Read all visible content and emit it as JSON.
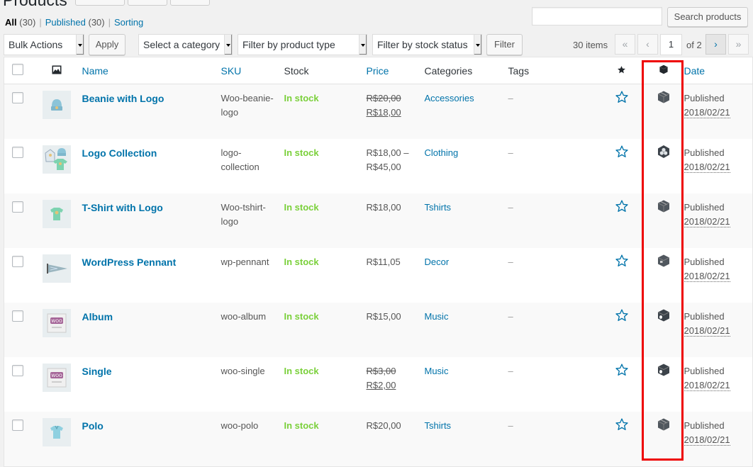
{
  "page": {
    "title": "Products"
  },
  "views": [
    {
      "label": "All",
      "count": "(30)",
      "current": true
    },
    {
      "label": "Published",
      "count": "(30)",
      "current": false
    },
    {
      "label": "Sorting",
      "count": "",
      "current": false
    }
  ],
  "search": {
    "value": "",
    "button_label": "Search products"
  },
  "toolbar": {
    "bulk_actions": "Bulk Actions",
    "apply_label": "Apply",
    "category_select": "Select a category",
    "product_type_select": "Filter by product type",
    "stock_status_select": "Filter by stock status",
    "filter_label": "Filter"
  },
  "pagination": {
    "items": "30 items",
    "first": "«",
    "prev": "‹",
    "current_page": "1",
    "of_total": "of 2",
    "next": "›",
    "last": "»"
  },
  "columns": {
    "name": "Name",
    "sku": "SKU",
    "stock": "Stock",
    "price": "Price",
    "categories": "Categories",
    "tags": "Tags",
    "date": "Date"
  },
  "colors": {
    "link": "#0073aa",
    "in_stock": "#7ad03a",
    "highlight": "#ee0000"
  },
  "products": [
    {
      "name": "Beanie with Logo",
      "sku": "Woo-beanie-logo",
      "stock": "In stock",
      "price_regular": "R$20,00",
      "price_sale": "R$18,00",
      "price": "",
      "category": "Accessories",
      "tags": "–",
      "type_icon": "simple-box-icon",
      "date_status": "Published",
      "date": "2018/02/21",
      "thumb": "beanie"
    },
    {
      "name": "Logo Collection",
      "sku": "logo-collection",
      "stock": "In stock",
      "price_regular": "",
      "price_sale": "",
      "price": "R$18,00 – R$45,00",
      "category": "Clothing",
      "tags": "–",
      "type_icon": "grouped-icon",
      "date_status": "Published",
      "date": "2018/02/21",
      "thumb": "collection"
    },
    {
      "name": "T-Shirt with Logo",
      "sku": "Woo-tshirt-logo",
      "stock": "In stock",
      "price_regular": "",
      "price_sale": "",
      "price": "R$18,00",
      "category": "Tshirts",
      "tags": "–",
      "type_icon": "simple-box-icon",
      "date_status": "Published",
      "date": "2018/02/21",
      "thumb": "tshirt"
    },
    {
      "name": "WordPress Pennant",
      "sku": "wp-pennant",
      "stock": "In stock",
      "price_regular": "",
      "price_sale": "",
      "price": "R$11,05",
      "category": "Decor",
      "tags": "–",
      "type_icon": "external-box-icon",
      "date_status": "Published",
      "date": "2018/02/21",
      "thumb": "pennant"
    },
    {
      "name": "Album",
      "sku": "woo-album",
      "stock": "In stock",
      "price_regular": "",
      "price_sale": "",
      "price": "R$15,00",
      "category": "Music",
      "tags": "–",
      "type_icon": "virtual-box-icon",
      "date_status": "Published",
      "date": "2018/02/21",
      "thumb": "album"
    },
    {
      "name": "Single",
      "sku": "woo-single",
      "stock": "In stock",
      "price_regular": "R$3,00",
      "price_sale": "R$2,00",
      "price": "",
      "category": "Music",
      "tags": "–",
      "type_icon": "virtual-box-icon",
      "date_status": "Published",
      "date": "2018/02/21",
      "thumb": "single"
    },
    {
      "name": "Polo",
      "sku": "woo-polo",
      "stock": "In stock",
      "price_regular": "",
      "price_sale": "",
      "price": "R$20,00",
      "category": "Tshirts",
      "tags": "–",
      "type_icon": "simple-box-icon",
      "date_status": "Published",
      "date": "2018/02/21",
      "thumb": "polo"
    }
  ]
}
